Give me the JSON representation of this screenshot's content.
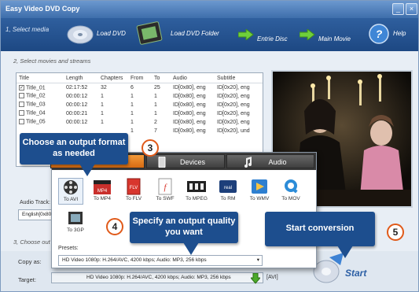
{
  "app": {
    "title": "Easy Video DVD Copy"
  },
  "step1": {
    "label": "1, Select media",
    "load_dvd": "Load DVD",
    "load_folder": "Load DVD Folder",
    "entire_disc": "Entrie Disc",
    "main_movie": "Main Movie",
    "help": "Help"
  },
  "step2": {
    "label": "2, Select movies and streams",
    "columns": [
      "Title",
      "Length",
      "Chapters",
      "From",
      "To",
      "Audio",
      "Subtitle"
    ],
    "rows": [
      {
        "title": "Title_01",
        "length": "02:17:52",
        "chapters": "32",
        "from": "6",
        "to": "25",
        "audio": "ID[0x80], eng",
        "subtitle": "ID[0x20], eng",
        "checked": true
      },
      {
        "title": "Title_02",
        "length": "00:00:12",
        "chapters": "1",
        "from": "1",
        "to": "1",
        "audio": "ID[0x80], eng",
        "subtitle": "ID[0x20], eng",
        "checked": false
      },
      {
        "title": "Title_03",
        "length": "00:00:12",
        "chapters": "1",
        "from": "1",
        "to": "1",
        "audio": "ID[0x80], eng",
        "subtitle": "ID[0x20], eng",
        "checked": false
      },
      {
        "title": "Title_04",
        "length": "00:00:21",
        "chapters": "1",
        "from": "1",
        "to": "1",
        "audio": "ID[0x80], eng",
        "subtitle": "ID[0x20], eng",
        "checked": false
      },
      {
        "title": "Title_05",
        "length": "00:00:12",
        "chapters": "1",
        "from": "1",
        "to": "2",
        "audio": "ID[0x80], eng",
        "subtitle": "ID[0x20], eng",
        "checked": false
      },
      {
        "title": "",
        "length": "",
        "chapters": "",
        "from": "1",
        "to": "7",
        "audio": "ID[0x80], eng",
        "subtitle": "ID[0x20], und",
        "checked": false
      }
    ],
    "audio_track_label": "Audio Track:",
    "audio_track_value": "English[0x80"
  },
  "step3": {
    "label": "3, Choose out",
    "copy_as_label": "Copy as:",
    "copy_as_value": "HD Video 1080p: H.264/AVC, 4200 kbps; Audio: MP3, 256 kbps",
    "target_label": "Target:",
    "target_value": "HD Video 1080p: H.264/AVC, 4200 kbps; Audio: MP3, 256 kbps",
    "target_ext": "[AVI]"
  },
  "popup": {
    "tabs": [
      "Devices",
      "Audio"
    ],
    "formats": [
      "To AVI",
      "To MP4",
      "To FLV",
      "To SWF",
      "To MPEG",
      "To RM",
      "To WMV",
      "To MOV",
      "To 3GP"
    ],
    "presets_label": "Presets:",
    "presets_value": "HD Video 1080p: H.264/AVC, 4200 kbps; Audio: MP3, 256 kbps"
  },
  "callouts": {
    "c1": "Choose an output format as needed",
    "c2": "Specify an output quality you want",
    "c3": "Start conversion"
  },
  "badges": [
    "3",
    "4",
    "5"
  ],
  "start": "Start",
  "colors": {
    "header": "#1d4883",
    "callout": "#1d4e8e",
    "badge_ring": "#e05a1a"
  }
}
